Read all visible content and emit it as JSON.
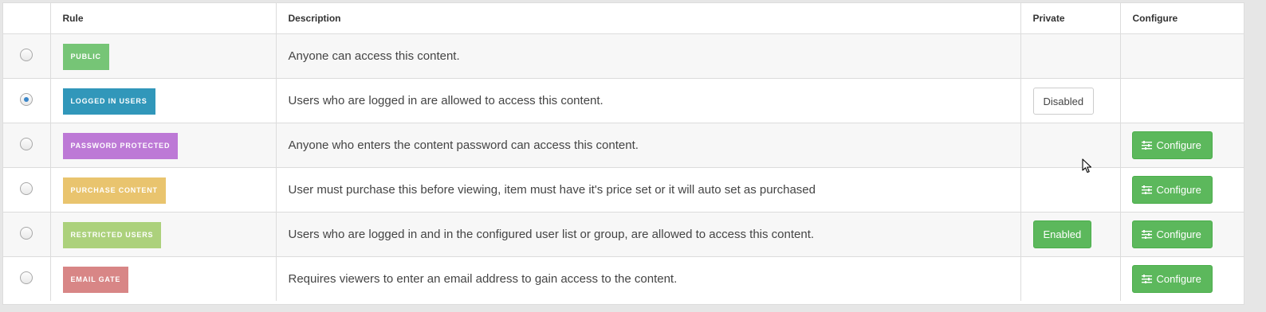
{
  "columns": {
    "rule": "Rule",
    "description": "Description",
    "private": "Private",
    "configure": "Configure"
  },
  "colors": {
    "public": "#76c576",
    "logged_in": "#3197ba",
    "password": "#bd79d6",
    "purchase": "#e9c46e",
    "restricted": "#acd17c",
    "email": "#d88686",
    "green_button": "#5cb85c"
  },
  "rows": [
    {
      "selected": false,
      "badge": "PUBLIC",
      "description": "Anyone can access this content.",
      "private": "",
      "configure": ""
    },
    {
      "selected": true,
      "badge": "LOGGED IN USERS",
      "description": "Users who are logged in are allowed to access this content.",
      "private": "Disabled",
      "configure": ""
    },
    {
      "selected": false,
      "badge": "PASSWORD PROTECTED",
      "description": "Anyone who enters the content password can access this content.",
      "private": "",
      "configure": "Configure"
    },
    {
      "selected": false,
      "badge": "PURCHASE CONTENT",
      "description": "User must purchase this before viewing, item must have it's price set or it will auto set as purchased",
      "private": "",
      "configure": "Configure"
    },
    {
      "selected": false,
      "badge": "RESTRICTED USERS",
      "description": "Users who are logged in and in the configured user list or group, are allowed to access this content.",
      "private": "Enabled",
      "configure": "Configure"
    },
    {
      "selected": false,
      "badge": "EMAIL GATE",
      "description": "Requires viewers to enter an email address to gain access to the content.",
      "private": "",
      "configure": "Configure"
    }
  ],
  "icons": {
    "configure": "sliders-icon",
    "cursor": "mouse-pointer-icon"
  }
}
